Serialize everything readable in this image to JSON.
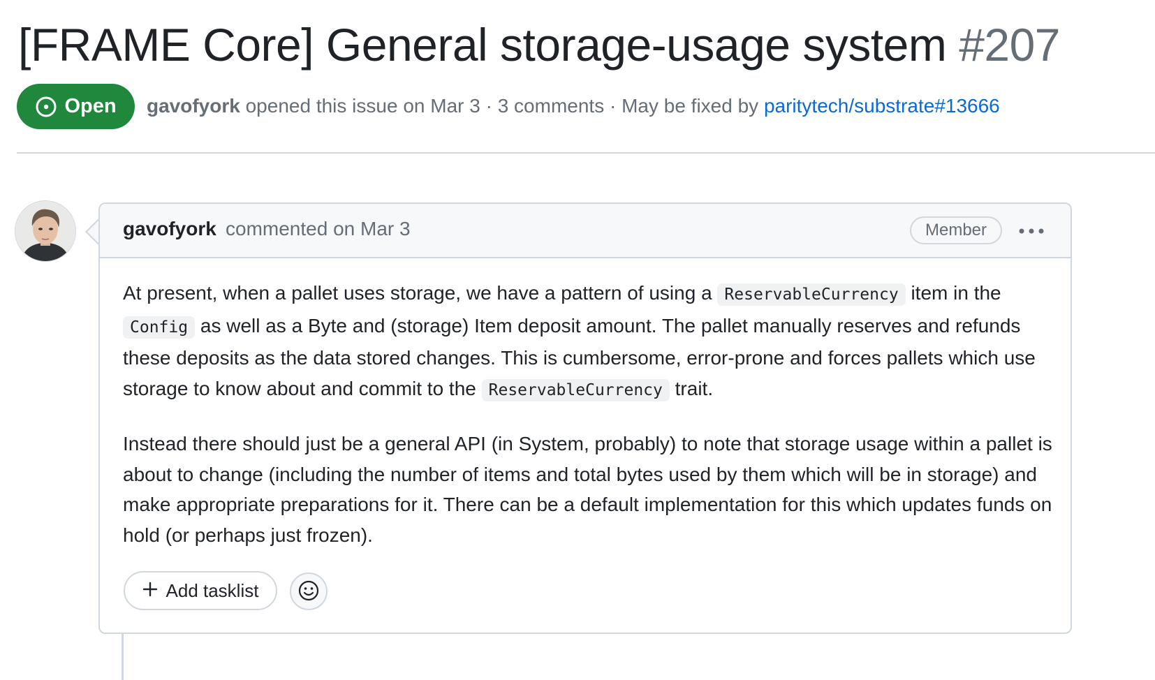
{
  "issue": {
    "title": "[FRAME Core] General storage-usage system",
    "number": "#207",
    "state": "Open",
    "state_color": "#1f883d",
    "author": "gavofyork",
    "meta_opened": " opened this issue on Mar 3 · 3 comments · May be fixed by ",
    "linked_pr": "paritytech/substrate#13666",
    "link_color": "#0969da"
  },
  "comment": {
    "author": "gavofyork",
    "timestamp": "commented on Mar 3",
    "role_badge": "Member",
    "menu_icon": "kebab-horizontal-icon",
    "avatar_icon": "user-avatar",
    "paragraphs": {
      "p1_part1": "At present, when a pallet uses storage, we have a pattern of using a ",
      "p1_code1": "ReservableCurrency",
      "p1_part2": " item in the ",
      "p1_code2": "Config",
      "p1_part3": " as well as a Byte and (storage) Item deposit amount. The pallet manually reserves and refunds these deposits as the data stored changes. This is cumbersome, error-prone and forces pallets which use storage to know about and commit to the ",
      "p1_code3": "ReservableCurrency",
      "p1_part4": " trait.",
      "p2": "Instead there should just be a general API (in System, probably) to note that storage usage within a pallet is about to change (including the number of items and total bytes used by them which will be in storage) and make appropriate preparations for it. There can be a default implementation for this which updates funds on hold (or perhaps just frozen)."
    },
    "actions": {
      "add_tasklist_label": "Add tasklist",
      "add_tasklist_icon": "plus-icon",
      "reaction_icon": "smiley-icon"
    }
  }
}
